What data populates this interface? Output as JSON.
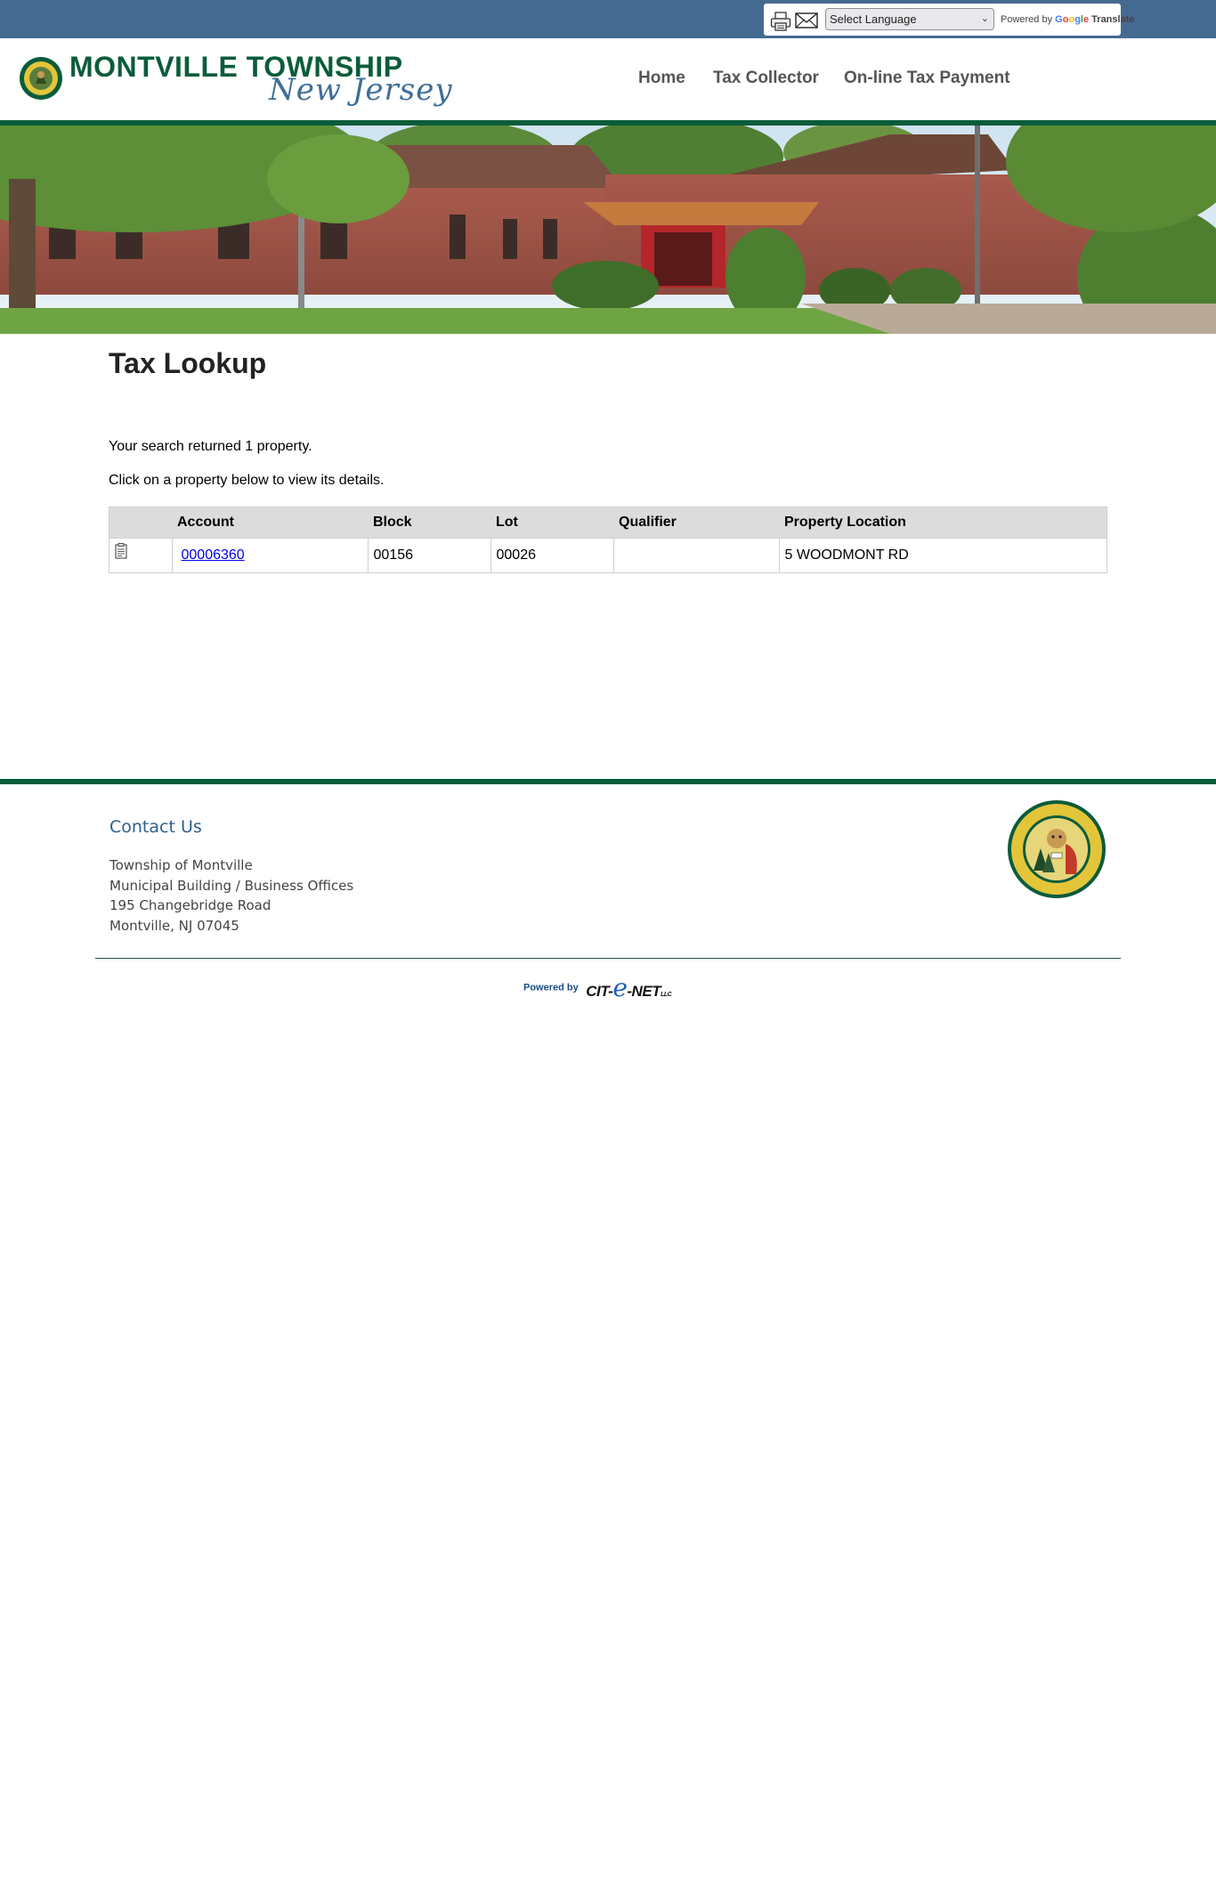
{
  "toolbar": {
    "language_select": "Select Language",
    "powered_by": "Powered by",
    "google": "Google",
    "translate": "Translate"
  },
  "header": {
    "brand_title": "MONTVILLE TOWNSHIP",
    "brand_sub": "New Jersey",
    "nav": [
      {
        "label": "Home"
      },
      {
        "label": "Tax Collector"
      },
      {
        "label": "On-line Tax Payment"
      }
    ]
  },
  "main": {
    "title": "Tax Lookup",
    "result_message": "Your search returned 1 property.",
    "instruction": "Click on a property below to view its details.",
    "table": {
      "headers": [
        "",
        "Account",
        "Block",
        "Lot",
        "Qualifier",
        "Property Location"
      ],
      "rows": [
        {
          "account": "00006360",
          "block": "00156",
          "lot": "00026",
          "qualifier": "",
          "location": "5 WOODMONT RD"
        }
      ]
    }
  },
  "footer": {
    "contact_title": "Contact Us",
    "address": [
      "Township of Montville",
      "Municipal Building / Business Offices",
      "195 Changebridge Road",
      "Montville, NJ 07045"
    ],
    "powered_by": "Powered by",
    "brand_prefix": "CIT-",
    "brand_e": "e",
    "brand_suffix": "-NET",
    "brand_llc": "LLC"
  },
  "colors": {
    "top_bar": "#456a91",
    "brand_green": "#0b5c3b",
    "brand_blue": "#3e6e98",
    "link": "#0000ee"
  },
  "icons": [
    "print-icon",
    "email-icon",
    "property-details-icon",
    "township-seal-icon"
  ]
}
